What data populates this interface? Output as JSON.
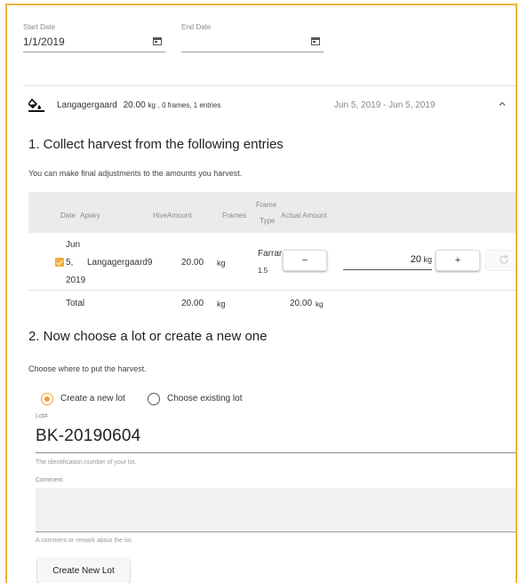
{
  "filters": {
    "start_date": {
      "label": "Start Date",
      "value": "1/1/2019"
    },
    "end_date": {
      "label": "End Date",
      "value": ""
    }
  },
  "panel": {
    "title_name": "Langagergaard",
    "title_amount": "20.00",
    "title_unit": "kg",
    "title_meta": ", 0 frames, 1 entries",
    "date_range": "Jun 5, 2019 - Jun 5, 2019"
  },
  "section1": {
    "heading": "1. Collect harvest from the following entries",
    "help": "You can make final adjustments to the amounts you harvest.",
    "columns": {
      "date": "Date",
      "apiary": "Apiary",
      "hive_amount": "HiveAmount",
      "frames": "Frames",
      "frame_type_1": "Frame",
      "frame_type_2": "Type",
      "actual_amount": "Actual Amount"
    },
    "rows": [
      {
        "date_line1": "Jun",
        "date_line2": "5,",
        "date_line3": "2019",
        "apiary": "Langagergaard9",
        "amount": "20.00",
        "unit": "kg",
        "frame_type": "Farrar",
        "frame_size": "1.5",
        "minus_label": "−",
        "actual_value": "20",
        "actual_unit": "kg",
        "plus_label": "+",
        "checked": true
      }
    ],
    "total": {
      "label": "Total",
      "amount": "20.00",
      "unit": "kg",
      "actual": "20.00",
      "actual_unit": "kg"
    }
  },
  "section2": {
    "heading": "2. Now choose a lot or create a new one",
    "help": "Choose where to put the harvest.",
    "radio_new": "Create a new lot",
    "radio_existing": "Choose existing lot",
    "lot_label": "Lot#",
    "lot_value": "BK-20190604",
    "lot_hint": "The identification number of your lot.",
    "comment_label": "Comment",
    "comment_value": "",
    "comment_hint": "A comment or remark about the lot.",
    "create_button": "Create New Lot"
  },
  "colors": {
    "accent": "#f0a030",
    "frame_border": "#f0b43a",
    "table_header": "#ebebeb"
  }
}
